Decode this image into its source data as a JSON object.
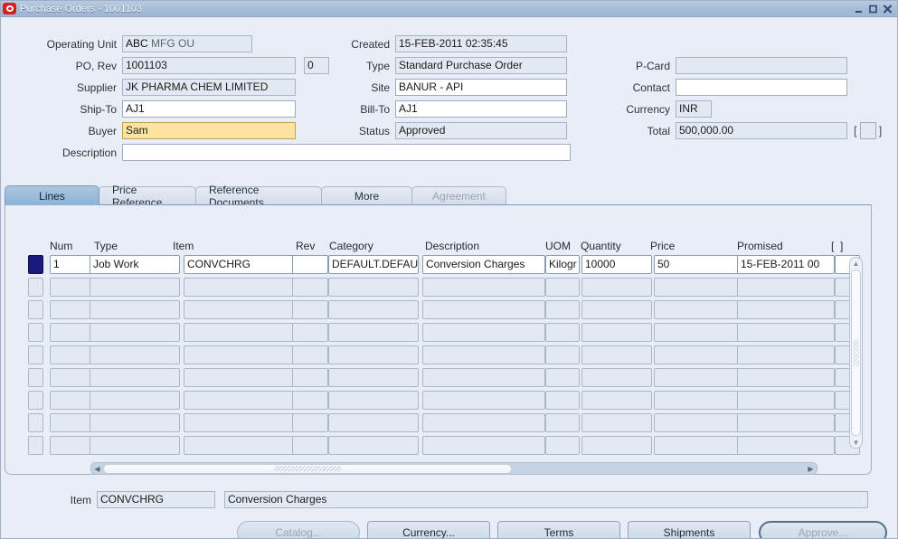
{
  "window": {
    "title": "Purchase Orders - 1001103",
    "icon": "oracle-logo-icon",
    "minimize": "minimize-icon",
    "maximize": "maximize-icon",
    "close": "close-icon"
  },
  "header": {
    "operating_unit": {
      "label": "Operating Unit",
      "value_strong": "ABC",
      "value_dim": "MFG OU"
    },
    "po": {
      "label": "PO, Rev",
      "value": "1001103",
      "rev": "0"
    },
    "supplier": {
      "label": "Supplier",
      "value": "JK PHARMA CHEM LIMITED"
    },
    "ship_to": {
      "label": "Ship-To",
      "value": "AJ1"
    },
    "buyer": {
      "label": "Buyer",
      "value": "Sam"
    },
    "description": {
      "label": "Description",
      "value": ""
    },
    "created": {
      "label": "Created",
      "value": "15-FEB-2011 02:35:45"
    },
    "type": {
      "label": "Type",
      "value": "Standard Purchase Order"
    },
    "site": {
      "label": "Site",
      "value": "BANUR - API"
    },
    "bill_to": {
      "label": "Bill-To",
      "value": "AJ1"
    },
    "status": {
      "label": "Status",
      "value": "Approved"
    },
    "p_card": {
      "label": "P-Card",
      "value": ""
    },
    "contact": {
      "label": "Contact",
      "value": ""
    },
    "currency": {
      "label": "Currency",
      "value": "INR"
    },
    "total": {
      "label": "Total",
      "value": "500,000.00"
    },
    "total_flex_open": "[",
    "total_flex_close": "]"
  },
  "tabs": [
    {
      "label": "Lines",
      "state": "active"
    },
    {
      "label": "Price Reference",
      "state": "enabled"
    },
    {
      "label": "Reference Documents",
      "state": "enabled"
    },
    {
      "label": "More",
      "state": "enabled"
    },
    {
      "label": "Agreement",
      "state": "disabled"
    }
  ],
  "lines_grid": {
    "columns": [
      "Num",
      "Type",
      "Item",
      "Rev",
      "Category",
      "Description",
      "UOM",
      "Quantity",
      "Price",
      "Promised"
    ],
    "flex_open": "[",
    "flex_close": "]",
    "rows": [
      {
        "selected": true,
        "num": "1",
        "type": "Job Work",
        "item": "CONVCHRG",
        "rev": "",
        "category": "DEFAULT.DEFAU",
        "description": "Conversion Charges",
        "uom": "Kilogr",
        "quantity": "10000",
        "price": "50",
        "promised": "15-FEB-2011 00",
        "flex": ""
      },
      {
        "selected": false,
        "num": "",
        "type": "",
        "item": "",
        "rev": "",
        "category": "",
        "description": "",
        "uom": "",
        "quantity": "",
        "price": "",
        "promised": "",
        "flex": ""
      },
      {
        "selected": false,
        "num": "",
        "type": "",
        "item": "",
        "rev": "",
        "category": "",
        "description": "",
        "uom": "",
        "quantity": "",
        "price": "",
        "promised": "",
        "flex": ""
      },
      {
        "selected": false,
        "num": "",
        "type": "",
        "item": "",
        "rev": "",
        "category": "",
        "description": "",
        "uom": "",
        "quantity": "",
        "price": "",
        "promised": "",
        "flex": ""
      },
      {
        "selected": false,
        "num": "",
        "type": "",
        "item": "",
        "rev": "",
        "category": "",
        "description": "",
        "uom": "",
        "quantity": "",
        "price": "",
        "promised": "",
        "flex": ""
      },
      {
        "selected": false,
        "num": "",
        "type": "",
        "item": "",
        "rev": "",
        "category": "",
        "description": "",
        "uom": "",
        "quantity": "",
        "price": "",
        "promised": "",
        "flex": ""
      },
      {
        "selected": false,
        "num": "",
        "type": "",
        "item": "",
        "rev": "",
        "category": "",
        "description": "",
        "uom": "",
        "quantity": "",
        "price": "",
        "promised": "",
        "flex": ""
      },
      {
        "selected": false,
        "num": "",
        "type": "",
        "item": "",
        "rev": "",
        "category": "",
        "description": "",
        "uom": "",
        "quantity": "",
        "price": "",
        "promised": "",
        "flex": ""
      },
      {
        "selected": false,
        "num": "",
        "type": "",
        "item": "",
        "rev": "",
        "category": "",
        "description": "",
        "uom": "",
        "quantity": "",
        "price": "",
        "promised": "",
        "flex": ""
      }
    ]
  },
  "footer": {
    "item_label": "Item",
    "item_value": "CONVCHRG",
    "item_description": "Conversion Charges"
  },
  "buttons": [
    {
      "label": "Catalog...",
      "state": "disabled",
      "rounded": true
    },
    {
      "label": "Currency...",
      "state": "enabled",
      "rounded": false
    },
    {
      "label": "Terms",
      "state": "enabled",
      "rounded": false
    },
    {
      "label": "Shipments",
      "state": "enabled",
      "rounded": false
    },
    {
      "label": "Approve...",
      "state": "disabled",
      "rounded": true
    }
  ],
  "colors": {
    "titlebar": "#a7bdd6",
    "canvas": "#e9eef6",
    "readonly_field": "#e3e9f2",
    "focused_field": "#fce4a0",
    "record_selected": "#1a1a7e",
    "active_tab": "#8cb4d6",
    "oracle_red": "#d81f1f"
  }
}
